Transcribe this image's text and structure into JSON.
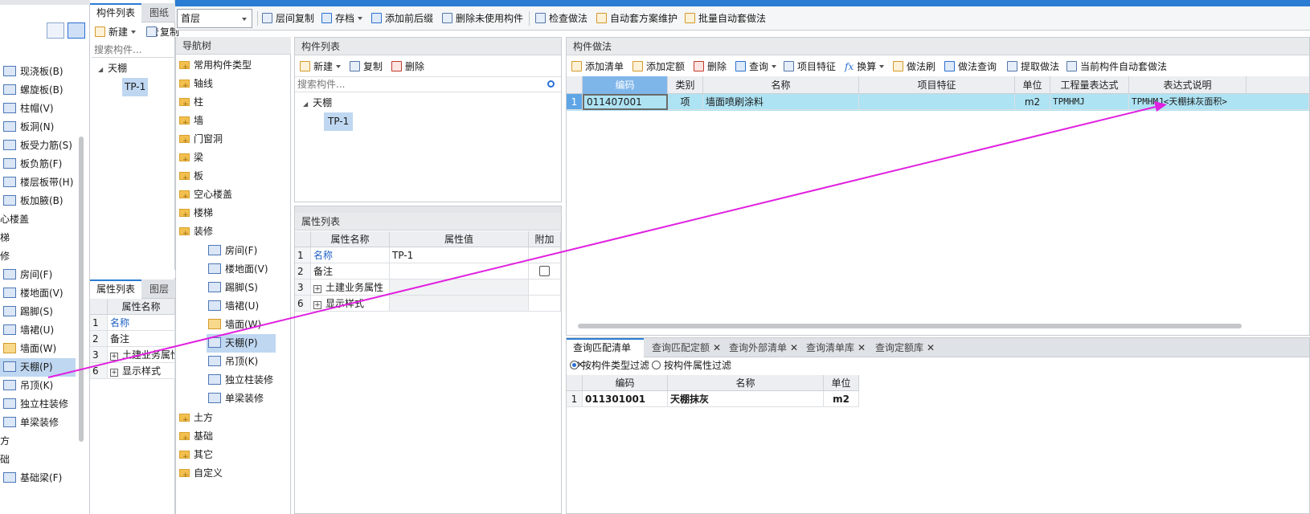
{
  "left_panel": {
    "items": [
      "现浇板(B)",
      "螺旋板(B)",
      "柱帽(V)",
      "板洞(N)",
      "板受力筋(S)",
      "板负筋(F)",
      "楼层板带(H)",
      "板加腋(B)"
    ],
    "partials": [
      "心楼盖",
      "梯",
      "修"
    ],
    "deco_items": [
      "房间(F)",
      "楼地面(V)",
      "踢脚(S)",
      "墙裙(U)",
      "墙面(W)",
      "天棚(P)",
      "吊顶(K)",
      "独立柱装修",
      "单梁装修"
    ],
    "bottom_partials": [
      "方",
      "础"
    ],
    "bottom_item": "基础梁(F)"
  },
  "comp_list_left": {
    "tabs": [
      "构件列表",
      "图纸管"
    ],
    "toolbar": {
      "new": "新建",
      "copy": "复制"
    },
    "search_placeholder": "搜索构件...",
    "tree_root": "天棚",
    "tree_child": "TP-1"
  },
  "prop_list_left": {
    "tabs": [
      "属性列表",
      "图层管"
    ],
    "col_name": "属性名称",
    "rows": [
      {
        "num": "1",
        "name": "名称"
      },
      {
        "num": "2",
        "name": "备注"
      },
      {
        "num": "3",
        "name": "土建业务属性"
      },
      {
        "num": "6",
        "name": "显示样式"
      }
    ]
  },
  "top_toolbar": {
    "floor": "首层",
    "buttons": [
      "层间复制",
      "存档",
      "添加前后缀",
      "删除未使用构件",
      "检查做法",
      "自动套方案维护",
      "批量自动套做法"
    ]
  },
  "nav_tree": {
    "title": "导航树",
    "top_items": [
      "常用构件类型",
      "轴线",
      "柱",
      "墙",
      "门窗洞",
      "梁",
      "板",
      "空心楼盖",
      "楼梯",
      "装修"
    ],
    "deco_children": [
      "房间(F)",
      "楼地面(V)",
      "踢脚(S)",
      "墙裙(U)",
      "墙面(W)",
      "天棚(P)",
      "吊顶(K)",
      "独立柱装修",
      "单梁装修"
    ],
    "bottom_items": [
      "土方",
      "基础",
      "其它",
      "自定义"
    ]
  },
  "comp_list": {
    "title": "构件列表",
    "toolbar": {
      "new": "新建",
      "copy": "复制",
      "delete": "删除"
    },
    "search_placeholder": "搜索构件...",
    "tree_root": "天棚",
    "tree_child": "TP-1"
  },
  "prop_list": {
    "title": "属性列表",
    "headers": [
      "属性名称",
      "属性值",
      "附加"
    ],
    "rows": [
      {
        "num": "1",
        "name": "名称",
        "value": "TP-1"
      },
      {
        "num": "2",
        "name": "备注",
        "value": ""
      },
      {
        "num": "3",
        "name": "土建业务属性",
        "value": ""
      },
      {
        "num": "6",
        "name": "显示样式",
        "value": ""
      }
    ]
  },
  "comp_method": {
    "title": "构件做法",
    "toolbar": [
      "添加清单",
      "添加定额",
      "删除",
      "查询",
      "项目特征",
      "换算",
      "做法刷",
      "做法查询",
      "提取做法",
      "当前构件自动套做法"
    ],
    "headers": [
      "编码",
      "类别",
      "名称",
      "项目特征",
      "单位",
      "工程量表达式",
      "表达式说明"
    ],
    "row": {
      "num": "1",
      "code": "011407001",
      "category": "项",
      "name": "墙面喷刷涂料",
      "feature": "",
      "unit": "m2",
      "expr": "TPMHMJ",
      "expr_desc": "TPMHMJ<天棚抹灰面积>"
    }
  },
  "query": {
    "tabs": [
      "查询匹配清单",
      "查询匹配定额",
      "查询外部清单",
      "查询清单库",
      "查询定额库"
    ],
    "filters": [
      "按构件类型过滤",
      "按构件属性过滤"
    ],
    "headers": [
      "编码",
      "名称",
      "单位"
    ],
    "row": {
      "num": "1",
      "code": "011301001",
      "name": "天棚抹灰",
      "unit": "m2"
    }
  },
  "colors": {
    "accent": "#2b7cd3",
    "selected_row": "#aee3f3",
    "arrow": "#e020e0",
    "header_cell": "#7fb6ea"
  }
}
